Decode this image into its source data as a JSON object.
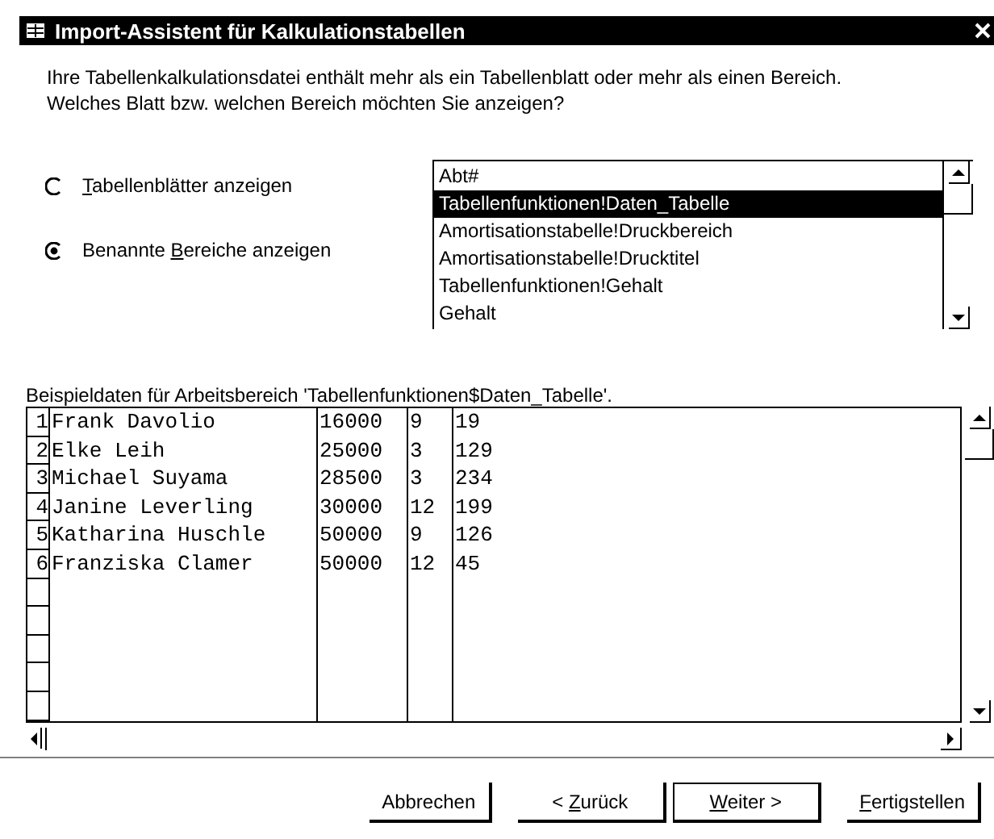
{
  "window": {
    "title": "Import-Assistent für Kalkulationstabellen"
  },
  "intro": "Ihre Tabellenkalkulationsdatei enthält mehr als ein Tabellenblatt oder mehr als einen Bereich. Welches Blatt bzw. welchen Bereich möchten Sie anzeigen?",
  "options": [
    {
      "access_key": "T",
      "label_post": "abellenblätter anzeigen",
      "selected": false
    },
    {
      "label_pre": "Benannte ",
      "access_key": "B",
      "label_post": "ereiche anzeigen",
      "selected": true
    }
  ],
  "ranges": [
    {
      "label": "Abt#",
      "selected": false
    },
    {
      "label": "Tabellenfunktionen!Daten_Tabelle",
      "selected": true
    },
    {
      "label": "Amortisationstabelle!Druckbereich",
      "selected": false
    },
    {
      "label": "Amortisationstabelle!Drucktitel",
      "selected": false
    },
    {
      "label": "Tabellenfunktionen!Gehalt",
      "selected": false
    },
    {
      "label": "Gehalt",
      "selected": false
    }
  ],
  "sample_caption": "Beispieldaten für Arbeitsbereich 'Tabellenfunktionen$Daten_Tabelle'.",
  "sample": {
    "rows": [
      {
        "number": "1",
        "cells": [
          "Frank Davolio",
          "16000",
          "9",
          "19"
        ]
      },
      {
        "number": "2",
        "cells": [
          "Elke Leih",
          "25000",
          "3",
          "129"
        ]
      },
      {
        "number": "3",
        "cells": [
          "Michael Suyama",
          "28500",
          "3",
          "234"
        ]
      },
      {
        "number": "4",
        "cells": [
          "Janine Leverling",
          "30000",
          "12",
          "199"
        ]
      },
      {
        "number": "5",
        "cells": [
          "Katharina Huschle",
          "50000",
          "9",
          "126"
        ]
      },
      {
        "number": "6",
        "cells": [
          "Franziska Clamer",
          "50000",
          "12",
          "45"
        ]
      }
    ]
  },
  "buttons": [
    {
      "label_post": "Abbrechen",
      "default": false
    },
    {
      "label_pre": "< ",
      "access_key": "Z",
      "label_post": "urück",
      "default": false
    },
    {
      "access_key": "W",
      "label_post": "eiter >",
      "default": true
    },
    {
      "access_key": "F",
      "label_post": "ertigstellen",
      "default": false
    }
  ]
}
